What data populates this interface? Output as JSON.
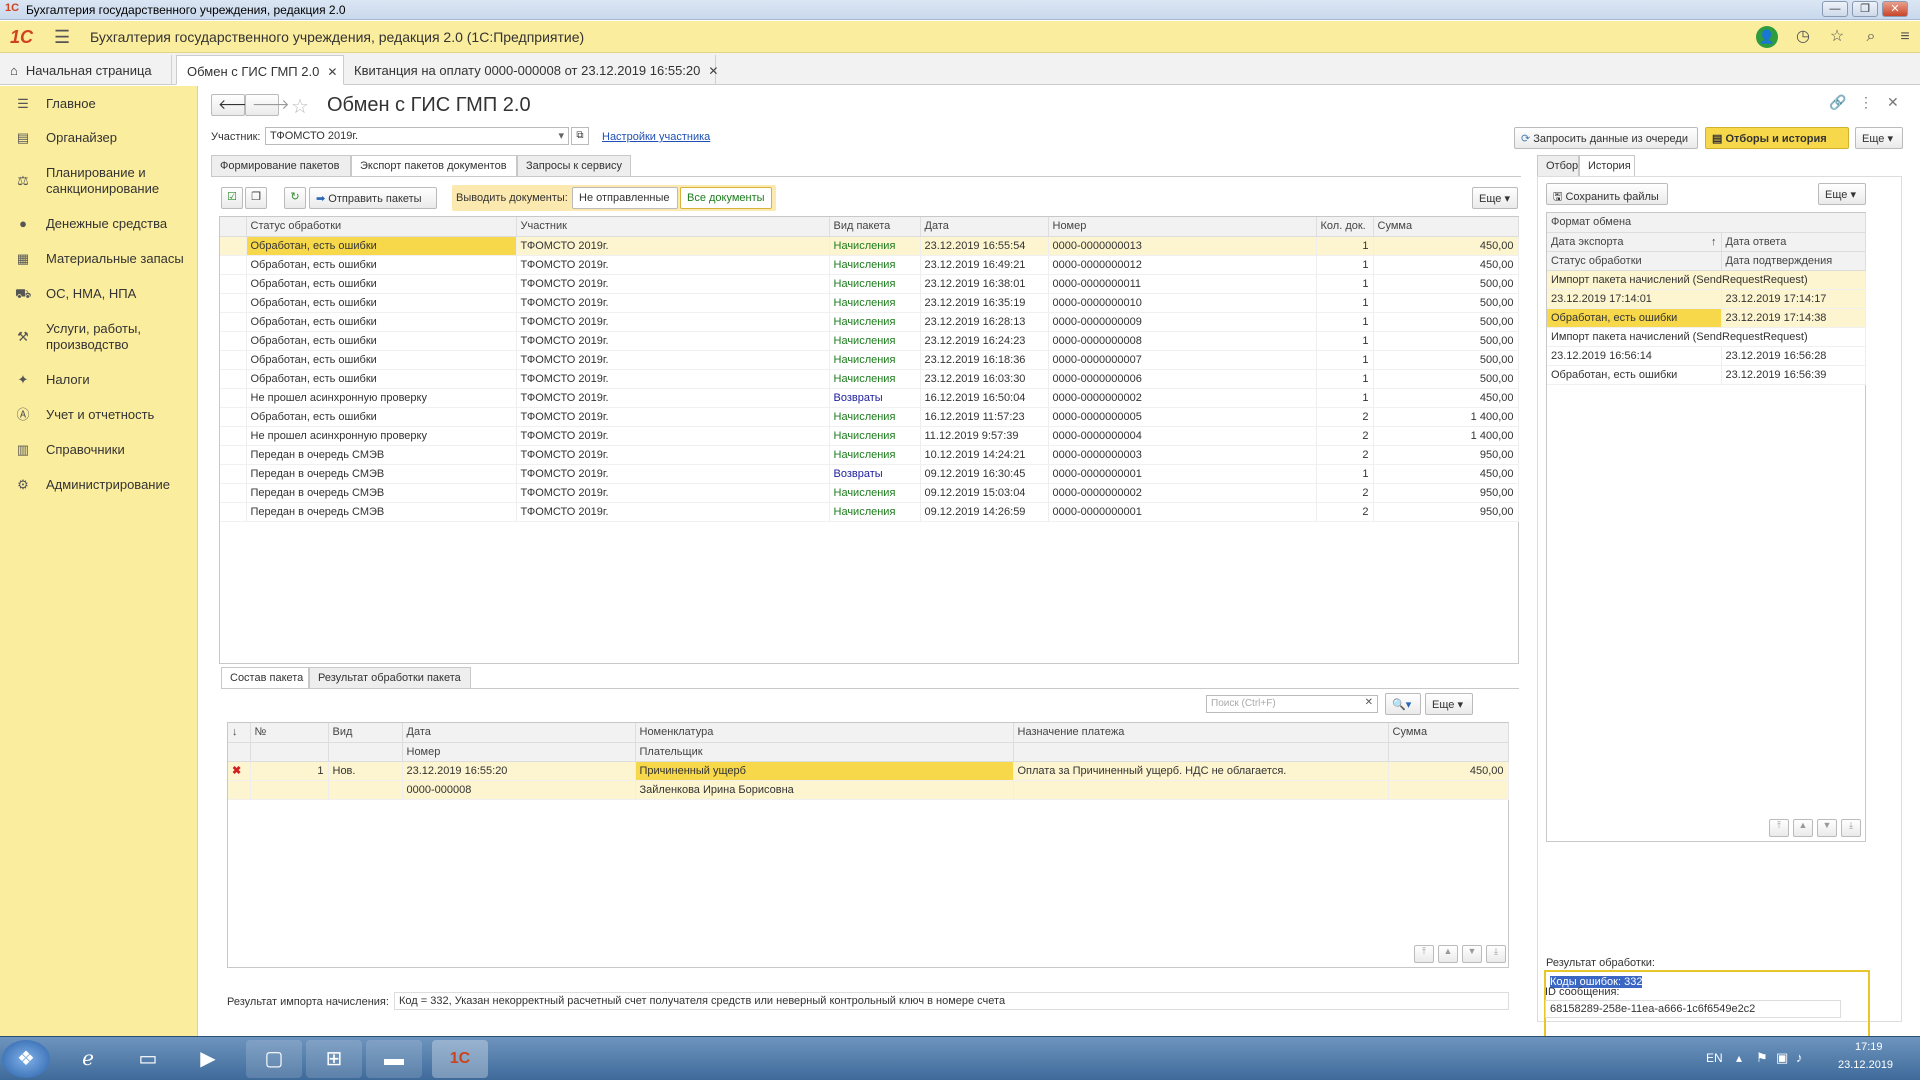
{
  "window": {
    "title": "Бухгалтерия государственного учреждения, редакция 2.0"
  },
  "app": {
    "brand": "1С",
    "title": "Бухгалтерия государственного учреждения, редакция 2.0  (1С:Предприятие)"
  },
  "tabs": [
    {
      "label": "Начальная страница"
    },
    {
      "label": "Обмен с ГИС ГМП 2.0"
    },
    {
      "label": "Квитанция на оплату 0000-000008 от 23.12.2019 16:55:20"
    }
  ],
  "sidebar": {
    "items": [
      {
        "label": "Главное",
        "icon": "menu-lines-icon"
      },
      {
        "label": "Органайзер",
        "icon": "organizer-icon"
      },
      {
        "label": "Планирование и санкционирование",
        "icon": "planning-icon"
      },
      {
        "label": "Денежные средства",
        "icon": "money-icon"
      },
      {
        "label": "Материальные запасы",
        "icon": "stock-icon"
      },
      {
        "label": "ОС, НМА, НПА",
        "icon": "truck-icon"
      },
      {
        "label": "Услуги, работы, производство",
        "icon": "services-icon"
      },
      {
        "label": "Налоги",
        "icon": "taxes-icon"
      },
      {
        "label": "Учет и отчетность",
        "icon": "accounting-icon"
      },
      {
        "label": "Справочники",
        "icon": "books-icon"
      },
      {
        "label": "Администрирование",
        "icon": "gear-icon"
      }
    ]
  },
  "form": {
    "title": "Обмен с ГИС ГМП 2.0",
    "participant_label": "Участник:",
    "participant_value": "ТФОМСТО 2019г.",
    "participant_settings_link": "Настройки участника",
    "request_button": "Запросить данные из очереди",
    "filters_button": "Отборы и история",
    "more": "Еще ▾",
    "subtabs": [
      "Формирование пакетов",
      "Экспорт пакетов документов",
      "Запросы к сервису"
    ],
    "send_button": "Отправить пакеты",
    "show_docs_label": "Выводить документы:",
    "show_options": [
      "Не отправленные",
      "Все документы"
    ]
  },
  "packages": {
    "columns": [
      "Статус обработки",
      "Участник",
      "Вид пакета",
      "Дата",
      "Номер",
      "Кол. док.",
      "Сумма"
    ],
    "rows": [
      [
        "Обработан, есть ошибки",
        "ТФОМСТО 2019г.",
        "Начисления",
        "23.12.2019 16:55:54",
        "0000-0000000013",
        "1",
        "450,00"
      ],
      [
        "Обработан, есть ошибки",
        "ТФОМСТО 2019г.",
        "Начисления",
        "23.12.2019 16:49:21",
        "0000-0000000012",
        "1",
        "450,00"
      ],
      [
        "Обработан, есть ошибки",
        "ТФОМСТО 2019г.",
        "Начисления",
        "23.12.2019 16:38:01",
        "0000-0000000011",
        "1",
        "500,00"
      ],
      [
        "Обработан, есть ошибки",
        "ТФОМСТО 2019г.",
        "Начисления",
        "23.12.2019 16:35:19",
        "0000-0000000010",
        "1",
        "500,00"
      ],
      [
        "Обработан, есть ошибки",
        "ТФОМСТО 2019г.",
        "Начисления",
        "23.12.2019 16:28:13",
        "0000-0000000009",
        "1",
        "500,00"
      ],
      [
        "Обработан, есть ошибки",
        "ТФОМСТО 2019г.",
        "Начисления",
        "23.12.2019 16:24:23",
        "0000-0000000008",
        "1",
        "500,00"
      ],
      [
        "Обработан, есть ошибки",
        "ТФОМСТО 2019г.",
        "Начисления",
        "23.12.2019 16:18:36",
        "0000-0000000007",
        "1",
        "500,00"
      ],
      [
        "Обработан, есть ошибки",
        "ТФОМСТО 2019г.",
        "Начисления",
        "23.12.2019 16:03:30",
        "0000-0000000006",
        "1",
        "500,00"
      ],
      [
        "Не прошел асинхронную проверку",
        "ТФОМСТО 2019г.",
        "Возвраты",
        "16.12.2019 16:50:04",
        "0000-0000000002",
        "1",
        "450,00"
      ],
      [
        "Обработан, есть ошибки",
        "ТФОМСТО 2019г.",
        "Начисления",
        "16.12.2019 11:57:23",
        "0000-0000000005",
        "2",
        "1 400,00"
      ],
      [
        "Не прошел асинхронную проверку",
        "ТФОМСТО 2019г.",
        "Начисления",
        "11.12.2019 9:57:39",
        "0000-0000000004",
        "2",
        "1 400,00"
      ],
      [
        "Передан в очередь СМЭВ",
        "ТФОМСТО 2019г.",
        "Начисления",
        "10.12.2019 14:24:21",
        "0000-0000000003",
        "2",
        "950,00"
      ],
      [
        "Передан в очередь СМЭВ",
        "ТФОМСТО 2019г.",
        "Возвраты",
        "09.12.2019 16:30:45",
        "0000-0000000001",
        "1",
        "450,00"
      ],
      [
        "Передан в очередь СМЭВ",
        "ТФОМСТО 2019г.",
        "Начисления",
        "09.12.2019 15:03:04",
        "0000-0000000002",
        "2",
        "950,00"
      ],
      [
        "Передан в очередь СМЭВ",
        "ТФОМСТО 2019г.",
        "Начисления",
        "09.12.2019 14:26:59",
        "0000-0000000001",
        "2",
        "950,00"
      ]
    ]
  },
  "bottom": {
    "tabs": [
      "Состав пакета",
      "Результат обработки пакета"
    ],
    "search_placeholder": "Поиск (Ctrl+F)",
    "columns": {
      "sort": "↓",
      "n": "№",
      "kind": "Вид",
      "date": "Дата",
      "number": "Номер",
      "nomen": "Номенклатура",
      "payer": "Плательщик",
      "purpose": "Назначение платежа",
      "sum": "Сумма"
    },
    "row": {
      "n": "1",
      "kind": "Нов.",
      "date": "23.12.2019 16:55:20",
      "number": "0000-000008",
      "nomen": "Причиненный ущерб",
      "payer": "Зайленкова Ирина Борисовна",
      "purpose": "Оплата за Причиненный ущерб. НДС не облагается.",
      "sum": "450,00"
    },
    "result_label": "Результат импорта начисления:",
    "result_value": "Код = 332, Указан некорректный расчетный счет получателя средств или неверный контрольный ключ в номере счета"
  },
  "right": {
    "tabs": [
      "Отбор",
      "История"
    ],
    "save_files": "Сохранить файлы",
    "col_format": "Формат обмена",
    "col_export_date": "Дата экспорта",
    "col_answer_date": "Дата ответа",
    "col_status": "Статус обработки",
    "col_confirm_date": "Дата подтверждения",
    "history": [
      {
        "format": "Импорт пакета начислений (SendRequestRequest)",
        "export": "23.12.2019 17:14:01",
        "answer": "23.12.2019 17:14:17",
        "status": "Обработан, есть ошибки",
        "confirm": "23.12.2019 17:14:38"
      },
      {
        "format": "Импорт пакета начислений (SendRequestRequest)",
        "export": "23.12.2019 16:56:14",
        "answer": "23.12.2019 16:56:28",
        "status": "Обработан, есть ошибки",
        "confirm": "23.12.2019 16:56:39"
      }
    ],
    "result_label": "Результат обработки:",
    "result_value": "Коды ошибок: 332",
    "msgid_label": "ID сообщения:",
    "msgid_value": "68158289-258e-11ea-a666-1c6f6549e2c2"
  },
  "taskbar": {
    "lang": "EN",
    "time": "17:19",
    "date": "23.12.2019"
  }
}
